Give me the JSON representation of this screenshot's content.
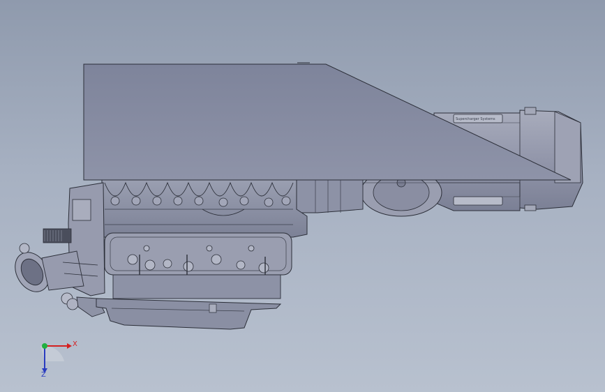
{
  "viewport": {
    "background_top": "#8f9aad",
    "background_bottom": "#b8c1cf",
    "part_fill": "#8a8fa4",
    "part_light": "#aeb2c2",
    "line_color": "#2b2e38"
  },
  "triad": {
    "x_label": "X",
    "y_label": "Z",
    "x_color": "#d42020",
    "y_color": "#2a3cc0",
    "origin_color": "#20b040"
  },
  "model": {
    "icons": [
      "engine-block-icon",
      "supercharger-icon",
      "throttle-body-icon",
      "oil-pan-icon",
      "intake-scoop-icon"
    ]
  }
}
